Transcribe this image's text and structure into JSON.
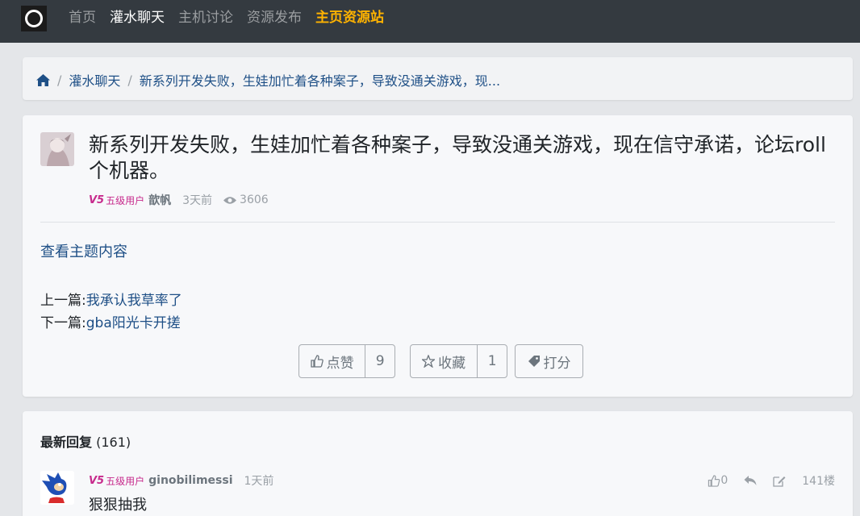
{
  "nav": {
    "items": [
      {
        "label": "首页",
        "state": "normal"
      },
      {
        "label": "灌水聊天",
        "state": "active"
      },
      {
        "label": "主机讨论",
        "state": "normal"
      },
      {
        "label": "资源发布",
        "state": "normal"
      },
      {
        "label": "主页资源站",
        "state": "highlight"
      }
    ]
  },
  "breadcrumb": {
    "home_icon": "home-icon",
    "items": [
      "灌水聊天",
      "新系列开发失败，生娃加忙着各种案子，导致没通关游戏，现..."
    ]
  },
  "thread": {
    "title": "新系列开发失败，生娃加忙着各种案子，导致没通关游戏，现在信守承诺，论坛roll个机器。",
    "level_badge": "V5",
    "level_label": "五级用户",
    "author": "歆帆",
    "time": "3天前",
    "views": "3606",
    "view_content": "查看主题内容",
    "prev_label": "上一篇:",
    "prev_title": "我承认我草率了",
    "next_label": "下一篇:",
    "next_title": "gba阳光卡开搓",
    "like_label": "点赞",
    "like_count": "9",
    "fav_label": "收藏",
    "fav_count": "1",
    "rate_label": "打分"
  },
  "replies": {
    "title": "最新回复",
    "count": "(161)",
    "items": [
      {
        "level_badge": "V5",
        "level_label": "五级用户",
        "author": "ginobilimessi",
        "time": "1天前",
        "likes": "0",
        "floor": "141楼",
        "content": "狠狠抽我"
      }
    ]
  },
  "colors": {
    "navbar": "#343a40",
    "highlight": "#ffb300",
    "link": "#1e4f86",
    "level": "#c72a8c"
  }
}
